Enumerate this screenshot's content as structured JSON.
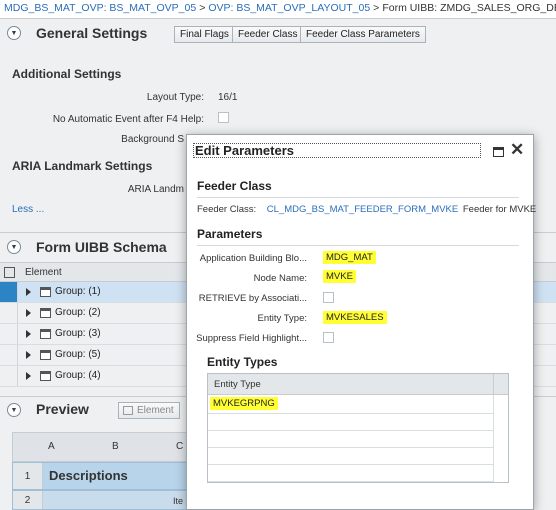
{
  "breadcrumb": {
    "items": [
      "MDG_BS_MAT_OVP: BS_MAT_OVP_05",
      "OVP: BS_MAT_OVP_LAYOUT_05"
    ],
    "separator": ">",
    "current": "Form UIBB: ZMDG_SALES_ORG_DETAILS"
  },
  "general_settings": {
    "title": "General Settings",
    "buttons": [
      "Final Flags",
      "Feeder Class",
      "Feeder Class Parameters"
    ]
  },
  "additional_settings": {
    "title": "Additional Settings",
    "layout_type_label": "Layout Type:",
    "layout_type_value": "16/1",
    "no_auto_event_label": "No Automatic Event after F4 Help:",
    "background_label": "Background S"
  },
  "aria": {
    "title": "ARIA Landmark Settings",
    "landmark_label": "ARIA Landm",
    "less_link": "Less ..."
  },
  "form_uibb_schema": {
    "title": "Form UIBB Schema",
    "column_header": "Element",
    "rows": [
      "Group: (1)",
      "Group: (2)",
      "Group: (3)",
      "Group: (5)",
      "Group: (4)"
    ]
  },
  "preview": {
    "title": "Preview",
    "element_button": "Element",
    "columns": [
      "A",
      "B",
      "C"
    ],
    "row1_number": "1",
    "row1_text": "Descriptions",
    "row2_number": "2",
    "row2_text": "Ite"
  },
  "dialog": {
    "title": "Edit Parameters",
    "feeder_class_heading": "Feeder Class",
    "feeder_class_label": "Feeder Class:",
    "feeder_class_value": "CL_MDG_BS_MAT_FEEDER_FORM_MVKE",
    "feeder_class_desc": "Feeder for MVKE",
    "parameters_heading": "Parameters",
    "params": [
      {
        "label": "Application Building Blo...",
        "value": "MDG_MAT"
      },
      {
        "label": "Node Name:",
        "value": "MVKE"
      },
      {
        "label": "RETRIEVE by Associati..."
      },
      {
        "label": "Entity Type:",
        "value": "MVKESALES"
      },
      {
        "label": "Suppress Field Highlight..."
      }
    ],
    "entity_types_heading": "Entity Types",
    "entity_types_column": "Entity Type",
    "entity_types_rows": [
      "MVKEGRPNG"
    ]
  },
  "colors": {
    "highlight": "#ffff33",
    "link": "#2a6ebb",
    "selected_row": "#cfe2f3"
  }
}
